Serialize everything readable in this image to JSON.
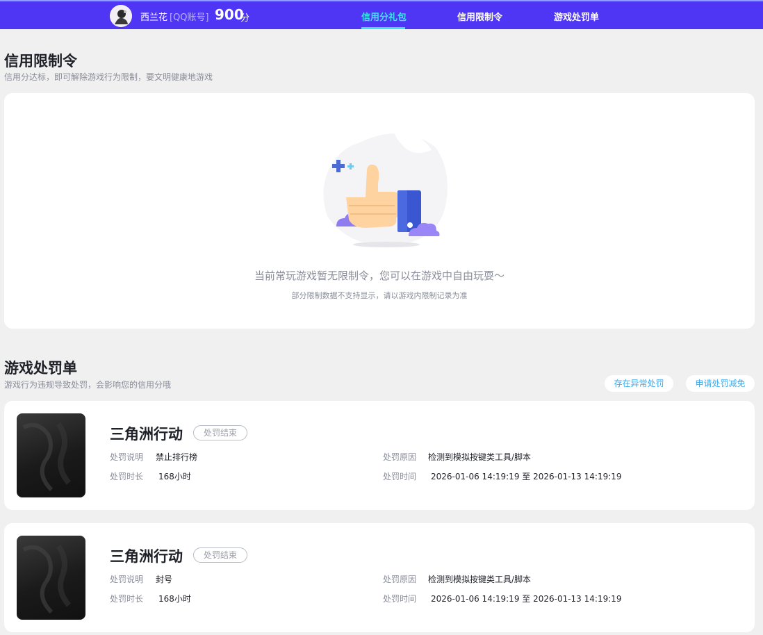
{
  "header": {
    "username": "西兰花",
    "account_type": "[QQ账号]",
    "score": "900",
    "score_unit": "分",
    "nav": [
      {
        "label": "信用分礼包",
        "active": true
      },
      {
        "label": "信用限制令",
        "active": false
      },
      {
        "label": "游戏处罚单",
        "active": false
      }
    ],
    "colors": {
      "bar": "#4f36f5",
      "active_tab": "#40e0f0"
    }
  },
  "restrictions": {
    "title": "信用限制令",
    "subtitle": "信用分达标，即可解除游戏行为限制，要文明健康地游戏",
    "empty_main": "当前常玩游戏暂无限制令，您可以在游戏中自由玩耍～",
    "empty_sub": "部分限制数据不支持显示，请以游戏内限制记录为准",
    "illustration_icon": "thumbs-up-icon"
  },
  "penalties": {
    "title": "游戏处罚单",
    "subtitle": "游戏行为违规导致处罚，会影响您的信用分哦",
    "actions": [
      "存在异常处罚",
      "申请处罚减免"
    ],
    "labels": {
      "desc": "处罚说明",
      "reason": "处罚原因",
      "duration": "处罚时长",
      "time": "处罚时间"
    },
    "items": [
      {
        "game": "三角洲行动",
        "status": "处罚结束",
        "desc": "禁止排行榜",
        "reason": "检测到模拟按键类工具/脚本",
        "duration": "168小时",
        "time": "2026-01-06 14:19:19 至 2026-01-13 14:19:19"
      },
      {
        "game": "三角洲行动",
        "status": "处罚结束",
        "desc": "封号",
        "reason": "检测到模拟按键类工具/脚本",
        "duration": "168小时",
        "time": "2026-01-06 14:19:19 至 2026-01-13 14:19:19"
      }
    ]
  }
}
